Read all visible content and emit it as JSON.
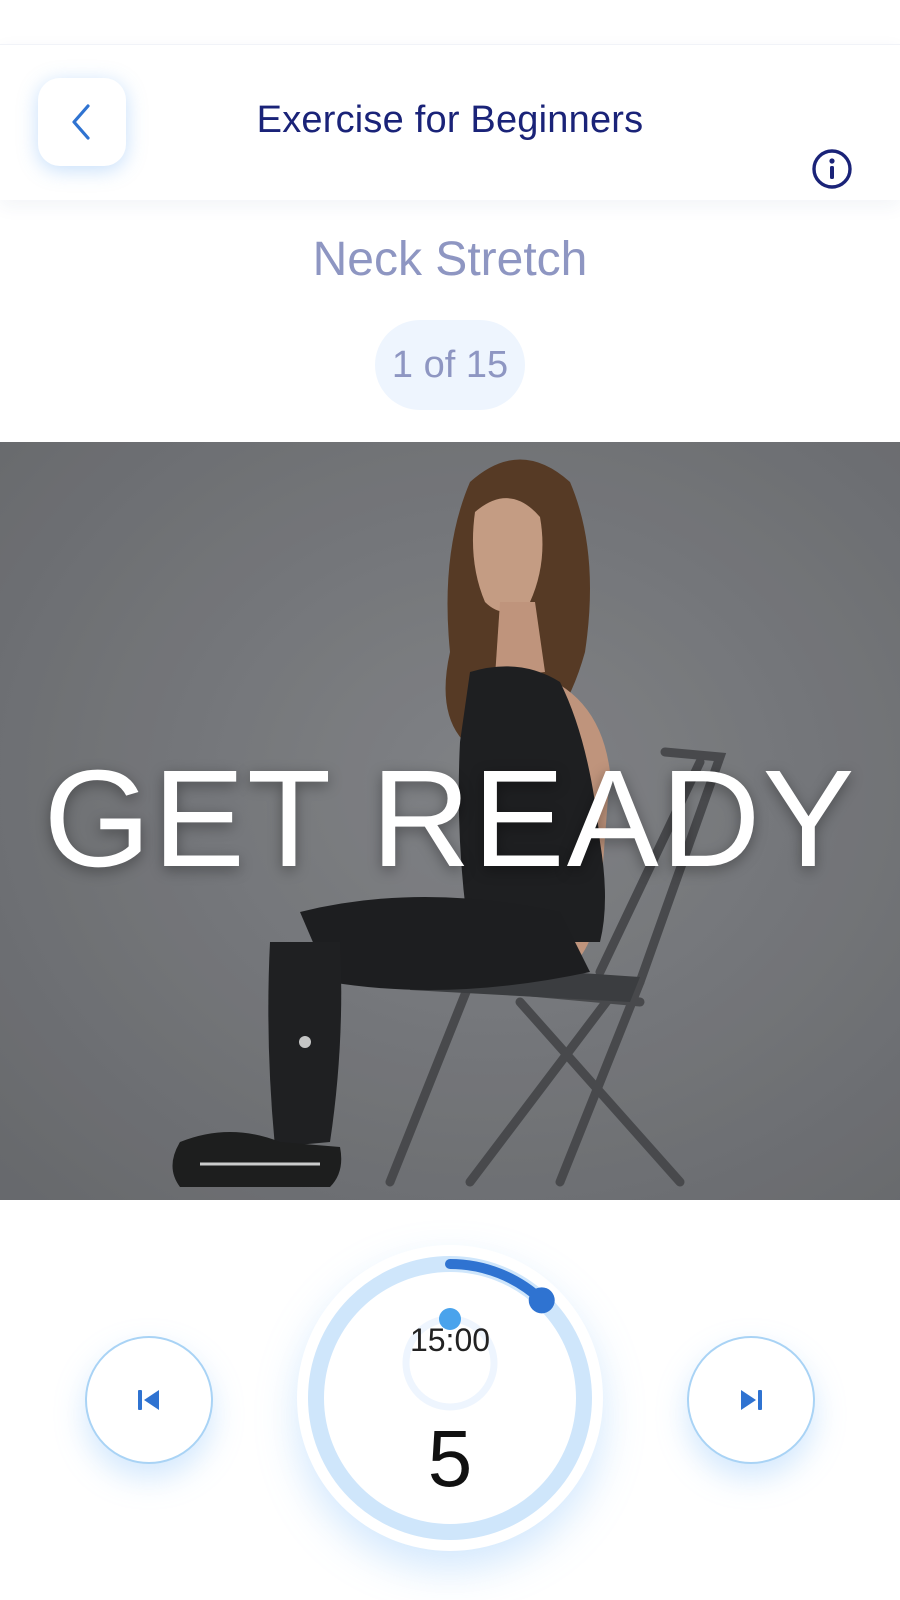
{
  "header": {
    "title": "Exercise for Beginners",
    "back_icon": "chevron-left-icon",
    "info_icon": "info-icon"
  },
  "exercise": {
    "name": "Neck Stretch",
    "step_label": "1 of 15"
  },
  "media": {
    "overlay_text": "GET READY"
  },
  "timer": {
    "total": "15:00",
    "countdown": "5",
    "progress_fraction": 0.12
  },
  "controls": {
    "prev_icon": "skip-previous-icon",
    "next_icon": "skip-next-icon"
  },
  "colors": {
    "title": "#1a2378",
    "subtitle": "#8e96c2",
    "accent": "#2f73d1",
    "ring": "#cfe6fb",
    "pill_bg": "#eef5fe"
  }
}
